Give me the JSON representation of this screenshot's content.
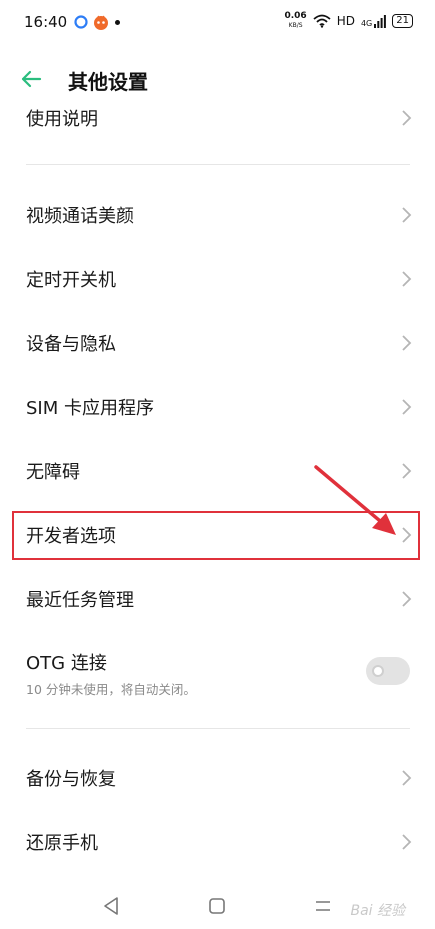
{
  "status_bar": {
    "time": "16:40",
    "speed_value": "0.06",
    "speed_unit": "KB/S",
    "network": "HD",
    "signal": "4G",
    "battery": "21"
  },
  "header": {
    "title": "其他设置",
    "back_icon": "back-arrow-icon"
  },
  "list": {
    "partial_item": "使用说明",
    "items": [
      {
        "label": "视频通话美颜"
      },
      {
        "label": "定时开关机"
      },
      {
        "label": "设备与隐私"
      },
      {
        "label": "SIM 卡应用程序"
      },
      {
        "label": "无障碍"
      },
      {
        "label": "开发者选项"
      },
      {
        "label": "最近任务管理"
      }
    ],
    "otg": {
      "label": "OTG 连接",
      "subtitle": "10 分钟未使用，将自动关闭。",
      "enabled": false
    },
    "bottom_items": [
      {
        "label": "备份与恢复"
      },
      {
        "label": "还原手机"
      }
    ]
  },
  "annotation": {
    "highlight_color": "#e0313b",
    "highlighted_item": "开发者选项"
  },
  "colors": {
    "accent": "#2bbd7e",
    "divider": "#e6e6e6",
    "chevron": "#b5b5b5"
  },
  "watermark": "Bai 经验"
}
